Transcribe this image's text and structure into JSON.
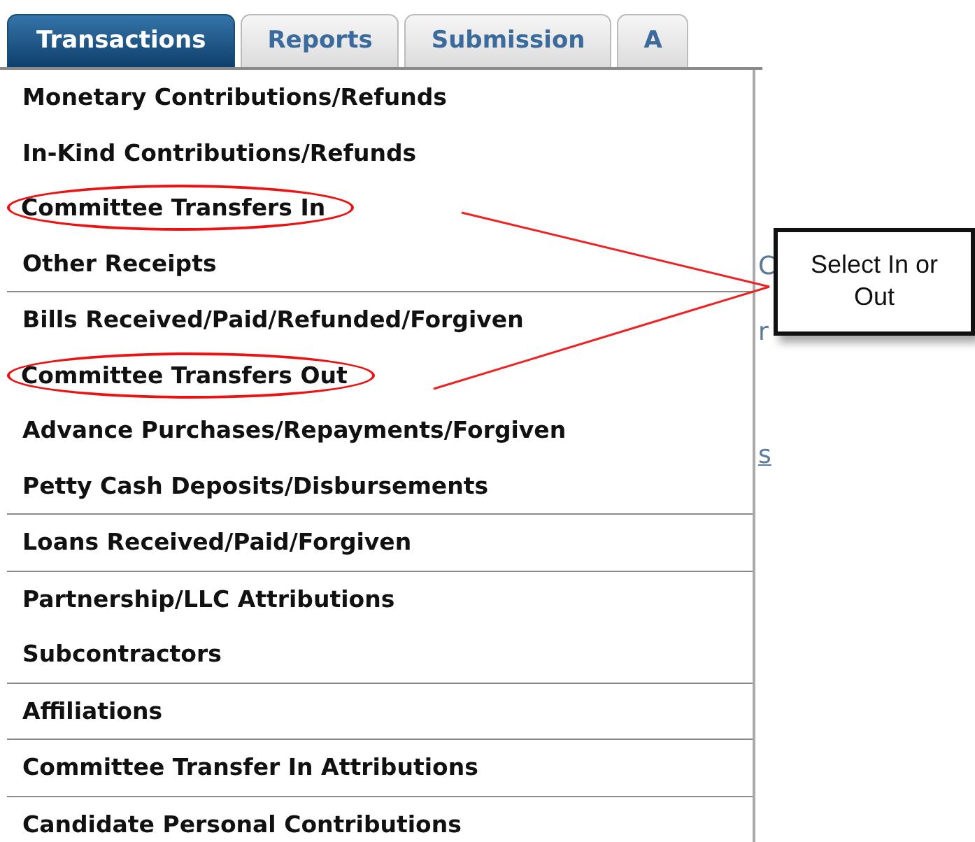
{
  "tabs": [
    {
      "label": "Transactions",
      "selected": true
    },
    {
      "label": "Reports",
      "selected": false
    },
    {
      "label": "Submission",
      "selected": false
    },
    {
      "label": "A",
      "selected": false
    }
  ],
  "menu_groups": [
    {
      "items": [
        {
          "label": "Monetary Contributions/Refunds",
          "highlighted": false
        },
        {
          "label": "In-Kind Contributions/Refunds",
          "highlighted": false
        },
        {
          "label": "Committee Transfers In",
          "highlighted": true
        },
        {
          "label": "Other Receipts",
          "highlighted": false
        }
      ]
    },
    {
      "items": [
        {
          "label": "Bills Received/Paid/Refunded/Forgiven",
          "highlighted": false
        },
        {
          "label": "Committee Transfers Out",
          "highlighted": true
        },
        {
          "label": "Advance Purchases/Repayments/Forgiven",
          "highlighted": false
        },
        {
          "label": "Petty Cash Deposits/Disbursements",
          "highlighted": false
        }
      ]
    },
    {
      "items": [
        {
          "label": "Loans Received/Paid/Forgiven",
          "highlighted": false
        }
      ]
    },
    {
      "items": [
        {
          "label": "Partnership/LLC Attributions",
          "highlighted": false
        },
        {
          "label": "Subcontractors",
          "highlighted": false
        }
      ]
    },
    {
      "items": [
        {
          "label": "Affiliations",
          "highlighted": false
        }
      ]
    },
    {
      "items": [
        {
          "label": "Committee Transfer In Attributions",
          "highlighted": false
        }
      ]
    },
    {
      "items": [
        {
          "label": "Candidate Personal Contributions",
          "highlighted": false
        }
      ]
    }
  ],
  "background_fragments": [
    "C",
    "r",
    "s"
  ],
  "callout": {
    "text": "Select In or Out"
  }
}
